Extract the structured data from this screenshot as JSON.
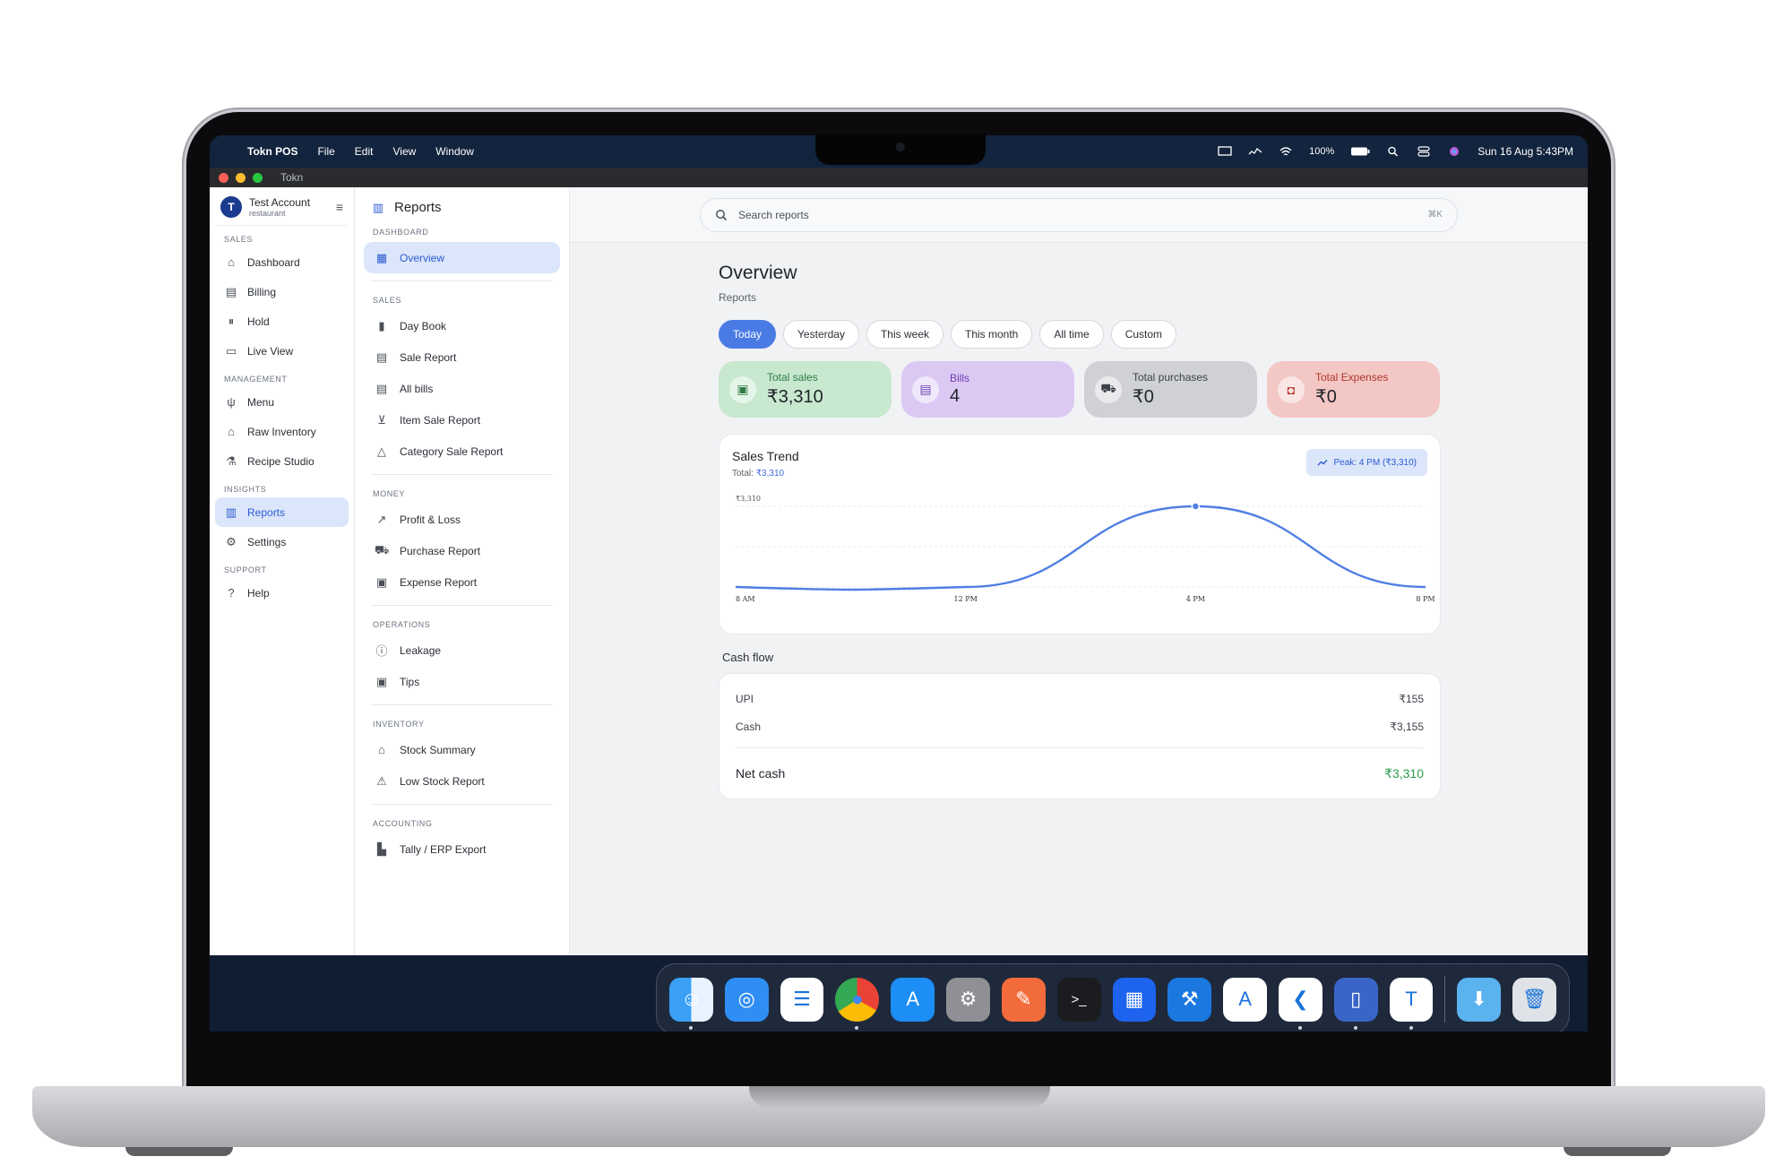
{
  "menubar": {
    "app_name": "Tokn POS",
    "menus": [
      "File",
      "Edit",
      "View",
      "Window"
    ],
    "battery": "100%",
    "datetime": "Sun 16 Aug  5:43PM"
  },
  "window": {
    "title": "Tokn"
  },
  "account": {
    "name": "Test Account",
    "type": "restaurant"
  },
  "sidebar": {
    "sections": {
      "sales": "SALES",
      "management": "MANAGEMENT",
      "insights": "INSIGHTS",
      "support": "SUPPORT"
    },
    "items": {
      "dashboard": "Dashboard",
      "billing": "Billing",
      "hold": "Hold",
      "live_view": "Live View",
      "menu": "Menu",
      "raw_inventory": "Raw Inventory",
      "recipe_studio": "Recipe Studio",
      "reports": "Reports",
      "settings": "Settings",
      "help": "Help"
    }
  },
  "subnav": {
    "title": "Reports",
    "sections": {
      "dashboard": "DASHBOARD",
      "sales": "SALES",
      "money": "MONEY",
      "operations": "OPERATIONS",
      "inventory": "INVENTORY",
      "accounting": "ACCOUNTING"
    },
    "items": {
      "overview": "Overview",
      "day_book": "Day Book",
      "sale_report": "Sale Report",
      "all_bills": "All bills",
      "item_sale_report": "Item Sale Report",
      "category_sale_report": "Category Sale Report",
      "profit_loss": "Profit & Loss",
      "purchase_report": "Purchase Report",
      "expense_report": "Expense Report",
      "leakage": "Leakage",
      "tips": "Tips",
      "stock_summary": "Stock Summary",
      "low_stock_report": "Low Stock Report",
      "tally_export": "Tally / ERP Export"
    }
  },
  "search": {
    "placeholder": "Search reports",
    "shortcut": "⌘K"
  },
  "overview": {
    "title": "Overview",
    "subtitle": "Reports",
    "filters": [
      "Today",
      "Yesterday",
      "This week",
      "This month",
      "All time",
      "Custom"
    ],
    "active_filter": "Today"
  },
  "stats": [
    {
      "label": "Total sales",
      "value": "₹3,310",
      "color": "#c8e8cf",
      "text_color": "#2e7d45",
      "icon": "cash-icon"
    },
    {
      "label": "Bills",
      "value": "4",
      "color": "#dcc9f3",
      "text_color": "#6e3fb3",
      "icon": "receipt-icon"
    },
    {
      "label": "Total purchases",
      "value": "₹0",
      "color": "#d0d1d4",
      "text_color": "#3b3f46",
      "icon": "truck-icon"
    },
    {
      "label": "Total Expenses",
      "value": "₹0",
      "color": "#f2c7c4",
      "text_color": "#b3362e",
      "icon": "expense-icon"
    }
  ],
  "sales_trend": {
    "title": "Sales Trend",
    "total_label": "Total: ",
    "total_value": "₹3,310",
    "peak": "Peak: 4 PM (₹3,310)"
  },
  "chart_data": {
    "type": "line",
    "x": [
      "8 AM",
      "12 PM",
      "4 PM",
      "8 PM"
    ],
    "series": [
      {
        "values": [
          0,
          0,
          3310,
          0
        ]
      }
    ],
    "xticks": [
      "8 AM",
      "12 PM",
      "4 PM",
      "8 PM"
    ],
    "yticks": [
      "₹3,310"
    ],
    "ylim": [
      0,
      3310
    ],
    "grid": true,
    "color": "#4f7fe3"
  },
  "cashflow": {
    "label": "Cash flow",
    "rows": [
      {
        "name": "UPI",
        "value": "₹155"
      },
      {
        "name": "Cash",
        "value": "₹3,155"
      }
    ],
    "net_label": "Net cash",
    "net_value": "₹3,310"
  },
  "dock": [
    "finder-icon",
    "safari-icon",
    "reminders-icon",
    "chrome-icon",
    "app-store-icon",
    "system-settings-icon",
    "postman-icon",
    "terminal-icon",
    "docker-icon",
    "xcode-icon",
    "instruments-icon",
    "vscode-icon",
    "simulator-icon",
    "tokn-icon",
    "downloads-folder-icon",
    "trash-icon"
  ]
}
